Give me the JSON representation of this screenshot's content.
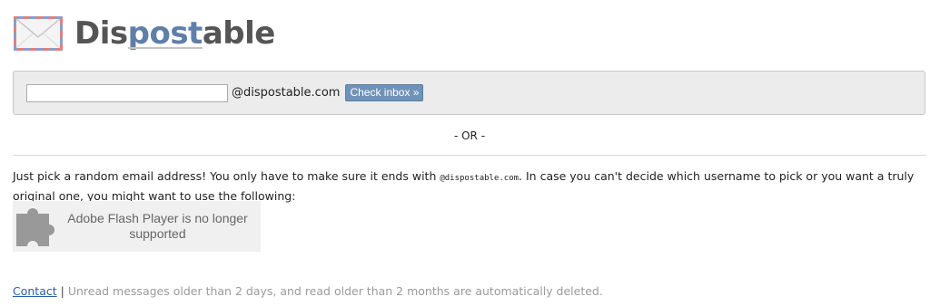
{
  "header": {
    "logo_part1": "Dis",
    "logo_part2": "post",
    "logo_part3": "able",
    "logo_icon": "envelope-icon"
  },
  "inbox_form": {
    "email_value": "",
    "email_placeholder": "",
    "domain": "@dispostable.com",
    "check_button_label": "Check inbox »"
  },
  "separator_text": "- OR -",
  "description": {
    "text_before": "Just pick a random email address! You only have to make sure it ends with ",
    "code": "@dispostable.com",
    "text_after": ". In case you can't decide which username to pick or you want a truly original one, you might want to use the following:"
  },
  "flash_plugin": {
    "icon": "puzzle-piece-icon",
    "message": "Adobe Flash Player is no longer supported"
  },
  "footer": {
    "contact_label": "Contact",
    "separator": "|",
    "notice": "Unread messages older than 2 days, and read older than 2 months are automatically deleted."
  },
  "colors": {
    "logo_gray": "#555555",
    "logo_blue": "#5f7fa8",
    "button_bg": "#6f93b8",
    "link": "#2a5fa0"
  }
}
